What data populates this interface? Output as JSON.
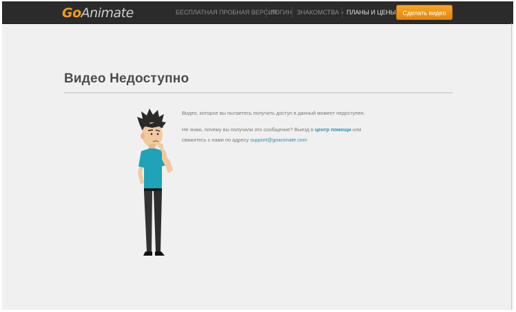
{
  "header": {
    "logo_go": "Go",
    "logo_rest": "Animate",
    "nav": [
      {
        "label": "Бесплатная пробная версия"
      },
      {
        "label": "Логин"
      },
      {
        "label": "Знакомства"
      },
      {
        "label": "Планы и цены"
      }
    ],
    "cta_label": "Сделать видео"
  },
  "main": {
    "title": "Видео Недоступно",
    "message_line1": "Видео, которое вы пытаетесь получить доступ в данный момент недоступен.",
    "message_line2_prefix": "Не знаю, почему вы получили это сообщение? Выезд в ",
    "help_link": "центр помощи",
    "message_line2_suffix": " или",
    "message_line3_prefix": "свяжитесь с нами по адресу ",
    "support_email": "support@goanimate.com"
  },
  "colors": {
    "accent": "#f39a1e",
    "link": "#2f8fb2",
    "navbar": "#2b2b2b",
    "background": "#f0f0f0"
  },
  "icons": {
    "dropdown": "chevron-down-icon",
    "illustration": "confused-man-illustration"
  }
}
